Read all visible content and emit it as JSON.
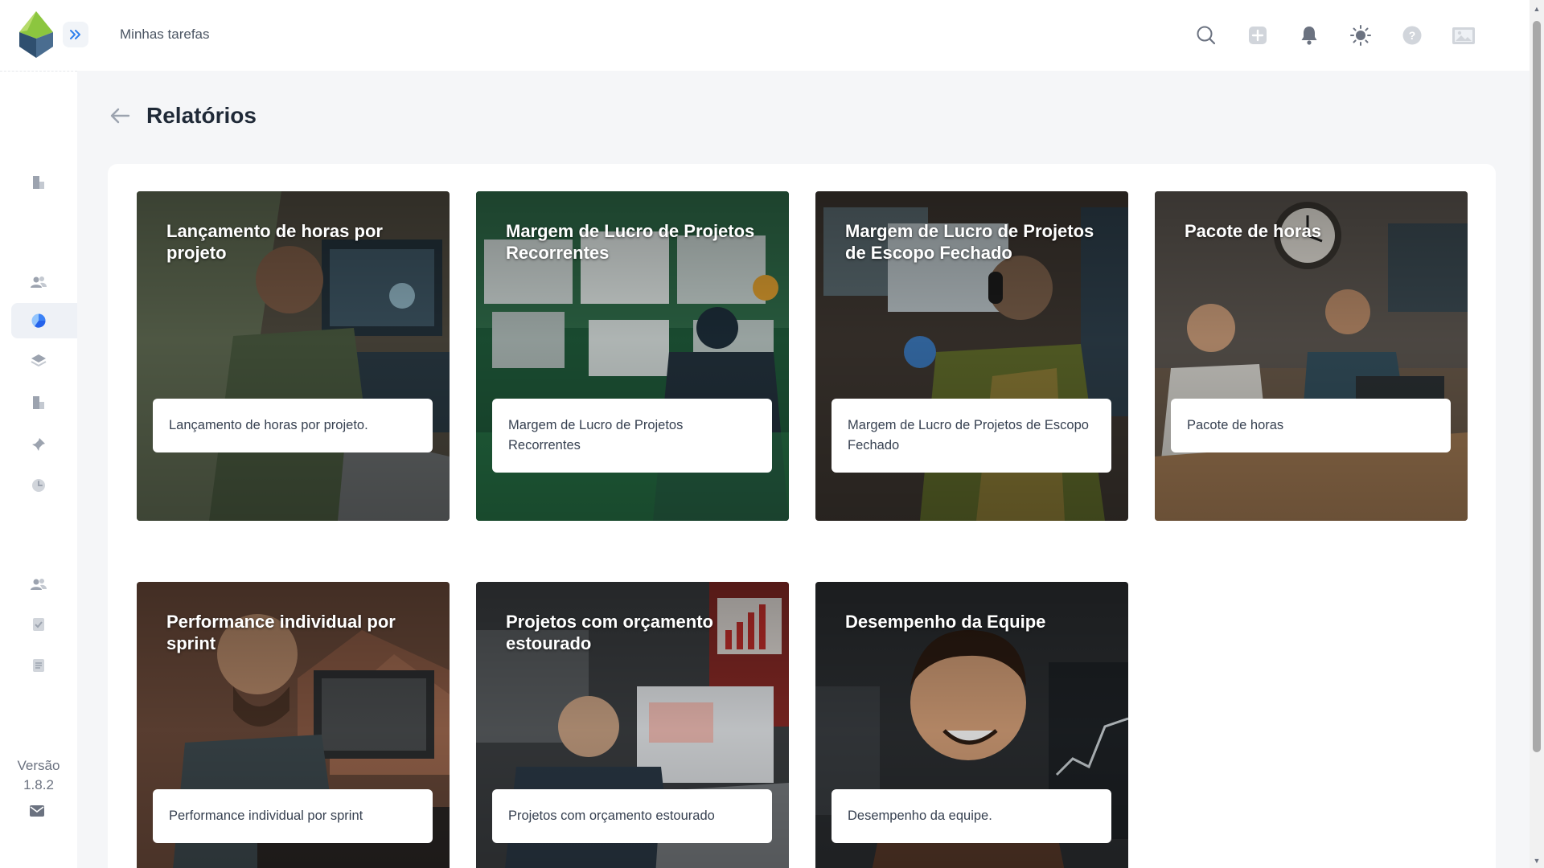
{
  "header": {
    "title": "Minhas tarefas",
    "icons": [
      "search-icon",
      "plus-icon",
      "bell-icon",
      "sun-icon",
      "help-icon",
      "image-icon"
    ]
  },
  "sidebar": {
    "items": [
      {
        "icon": "building-icon"
      },
      {
        "icon": "users-icon"
      },
      {
        "icon": "pie-chart-icon",
        "active": true
      },
      {
        "icon": "layers-icon"
      },
      {
        "icon": "building-icon"
      },
      {
        "icon": "pin-icon"
      },
      {
        "icon": "clock-icon"
      },
      {
        "icon": "users-icon"
      },
      {
        "icon": "checklist-icon"
      },
      {
        "icon": "document-icon"
      }
    ],
    "version_label": "Versão",
    "version_number": "1.8.2"
  },
  "page": {
    "title": "Relatórios"
  },
  "reports": [
    {
      "title": "Lançamento de horas por projeto",
      "description": "Lançamento de horas por projeto."
    },
    {
      "title": "Margem de Lucro de Projetos Recorrentes",
      "description": "Margem de Lucro de Projetos Recorrentes"
    },
    {
      "title": "Margem de Lucro de Projetos de Escopo Fechado",
      "description": "Margem de Lucro de Projetos de Escopo Fechado"
    },
    {
      "title": "Pacote de horas",
      "description": "Pacote de horas"
    },
    {
      "title": "Performance individual por sprint",
      "description": "Performance individual por sprint"
    },
    {
      "title": "Projetos com orçamento estourado",
      "description": "Projetos com orçamento estourado"
    },
    {
      "title": "Desempenho da Equipe",
      "description": "Desempenho da equipe."
    }
  ],
  "colors": {
    "accent": "#2f80ed",
    "logo_green": "#8cc63f",
    "logo_blue": "#3b5b7d",
    "active_icon": "#3b82f6"
  }
}
